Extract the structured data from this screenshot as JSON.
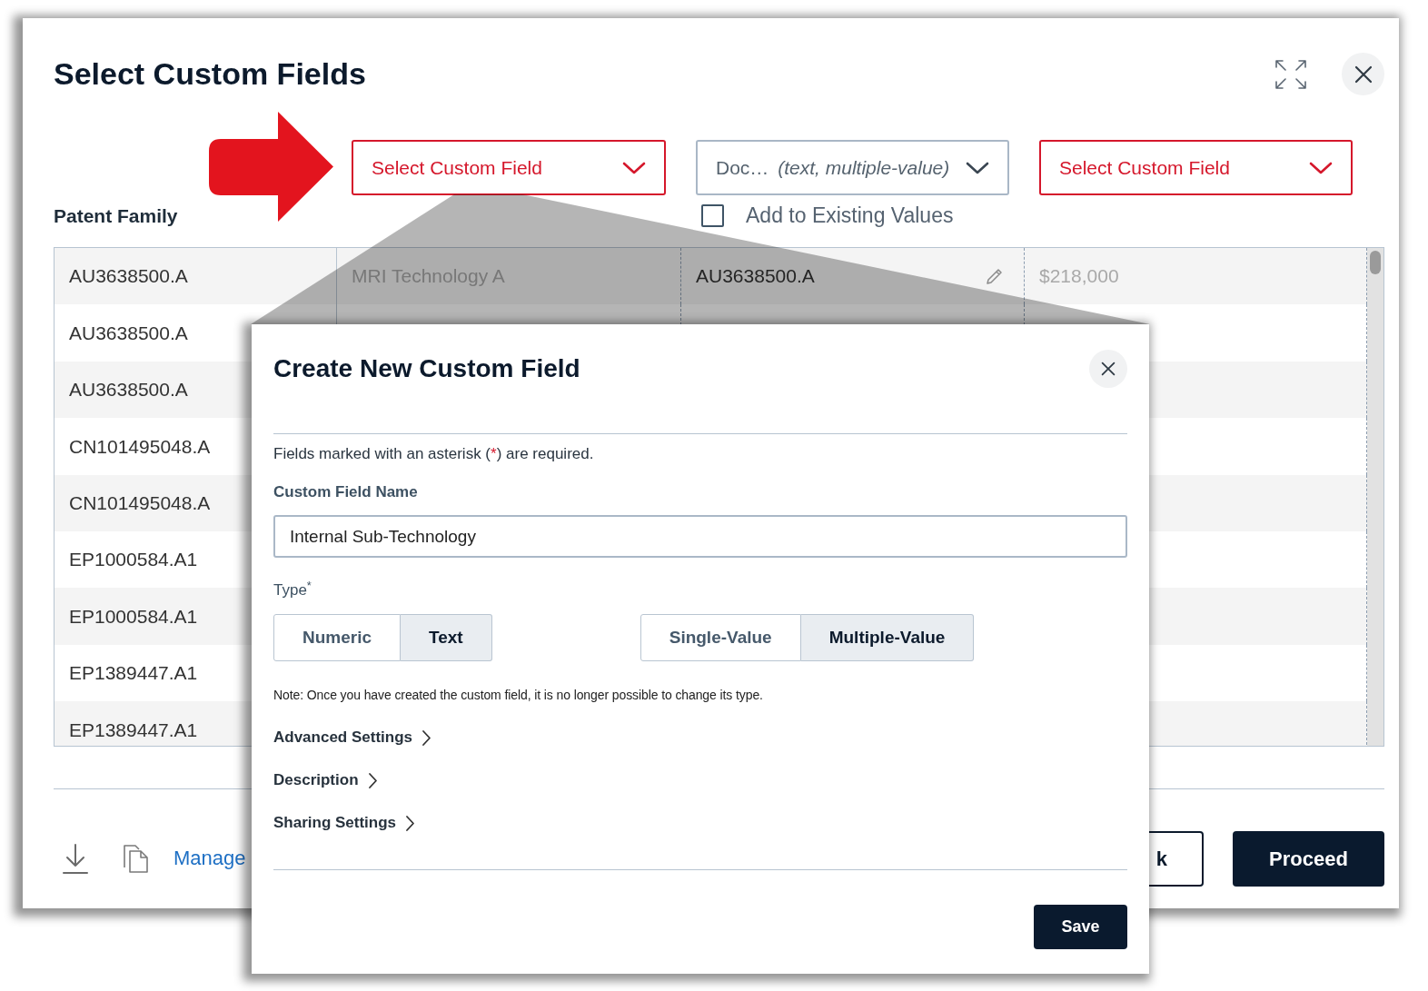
{
  "dialog": {
    "title": "Select Custom Fields"
  },
  "mapping": {
    "row_header": "Patent Family",
    "columns": [
      {
        "label": "Select Custom Field",
        "invalid": true
      },
      {
        "label": "Doc…",
        "detail": "(text, multiple-value)",
        "invalid": false,
        "option": {
          "label": "Add to Existing Values",
          "checked": false
        }
      },
      {
        "label": "Select Custom Field",
        "invalid": true
      }
    ]
  },
  "table": {
    "rows": [
      {
        "cells": [
          {
            "text": "AU3638500.A",
            "muted": false,
            "editable": false
          },
          {
            "text": "MRI Technology A",
            "muted": true,
            "editable": false
          },
          {
            "text": "AU3638500.A",
            "muted": false,
            "editable": true
          },
          {
            "text": "$218,000",
            "muted": true,
            "editable": false
          }
        ]
      },
      {
        "cells": [
          {
            "text": "AU3638500.A",
            "muted": false,
            "editable": false
          }
        ]
      },
      {
        "cells": [
          {
            "text": "AU3638500.A",
            "muted": false,
            "editable": false
          }
        ]
      },
      {
        "cells": [
          {
            "text": "CN101495048.A",
            "muted": false,
            "editable": false
          }
        ]
      },
      {
        "cells": [
          {
            "text": "CN101495048.A",
            "muted": false,
            "editable": false
          }
        ]
      },
      {
        "cells": [
          {
            "text": "EP1000584.A1",
            "muted": false,
            "editable": false
          }
        ]
      },
      {
        "cells": [
          {
            "text": "EP1000584.A1",
            "muted": false,
            "editable": false
          }
        ]
      },
      {
        "cells": [
          {
            "text": "EP1389447.A1",
            "muted": false,
            "editable": false
          }
        ]
      },
      {
        "cells": [
          {
            "text": "EP1389447.A1",
            "muted": false,
            "editable": false
          }
        ]
      }
    ]
  },
  "footer": {
    "link": "Manage",
    "buttons": [
      {
        "label": "k",
        "kind": "outline"
      },
      {
        "label": "Proceed",
        "kind": "primary"
      }
    ]
  },
  "modal": {
    "title": "Create New Custom Field",
    "required_note": {
      "before": "Fields marked with an asterisk (",
      "mark": "*",
      "after": ") are required."
    },
    "name_field": {
      "label": "Custom Field Name",
      "value": "Internal Sub-Technology"
    },
    "type_label": "Type$^{*}$",
    "type_options": [
      {
        "label": "Numeric",
        "selected": false
      },
      {
        "label": "Text",
        "selected": true
      }
    ],
    "value_options": [
      {
        "label": "Single-Value",
        "selected": false
      },
      {
        "label": "Multiple-Value",
        "selected": true
      }
    ],
    "note": "Note: Once you have created the custom field, it is no longer possible to change its type.",
    "sections": [
      {
        "label": "Advanced Settings",
        "expanded": false
      },
      {
        "label": "Description",
        "expanded": false
      },
      {
        "label": "Sharing Settings",
        "expanded": false
      }
    ],
    "save": "Save"
  }
}
